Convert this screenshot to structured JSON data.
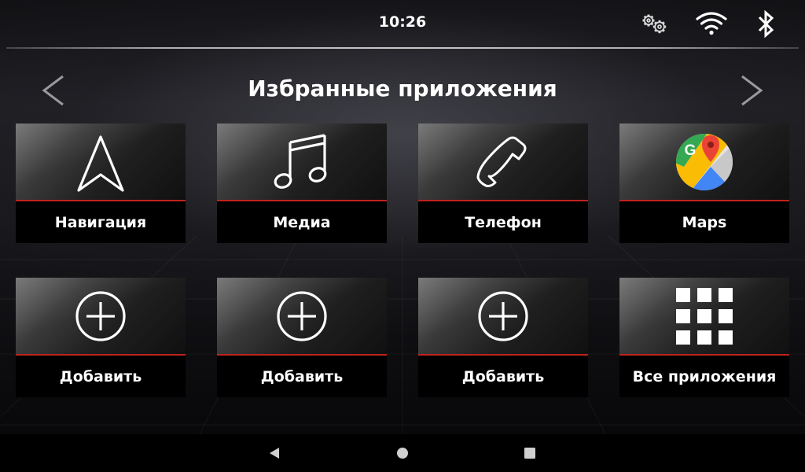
{
  "status_bar": {
    "time": "10:26",
    "icons": [
      "settings-gears-icon",
      "wifi-icon",
      "bluetooth-icon"
    ]
  },
  "header": {
    "title": "Избранные приложения",
    "prev_icon": "chevron-left-icon",
    "next_icon": "chevron-right-icon"
  },
  "tiles": [
    {
      "label": "Навигация",
      "icon": "navigation-arrow-icon"
    },
    {
      "label": "Медиа",
      "icon": "music-note-icon"
    },
    {
      "label": "Телефон",
      "icon": "phone-icon"
    },
    {
      "label": "Maps",
      "icon": "google-maps-icon"
    },
    {
      "label": "Добавить",
      "icon": "add-circle-icon"
    },
    {
      "label": "Добавить",
      "icon": "add-circle-icon"
    },
    {
      "label": "Добавить",
      "icon": "add-circle-icon"
    },
    {
      "label": "Все приложения",
      "icon": "app-grid-icon"
    }
  ],
  "nav_bar": {
    "buttons": [
      "back-triangle-icon",
      "home-circle-icon",
      "recents-square-icon"
    ]
  },
  "colors": {
    "accent_red": "#c0221f",
    "text": "#ffffff",
    "background": "#000000"
  }
}
